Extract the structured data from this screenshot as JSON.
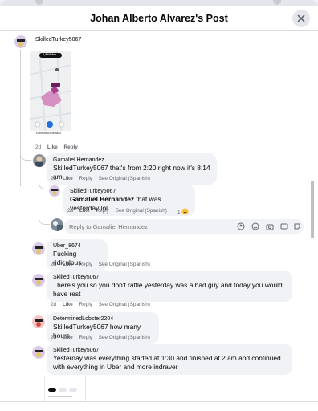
{
  "header": {
    "title": "Johan Alberto Alvarez's Post"
  },
  "comments": [
    {
      "author": "SkilledTurkey5067",
      "time": "2d",
      "like": "Like",
      "reply": "Reply",
      "image": {
        "chip": "1,944.4m",
        "pin_label": "",
        "footer": "Entre desconectado"
      }
    },
    {
      "author": "Gamaliel Hernandez",
      "text": "SkilledTurkey5067 that's from 2:20 right now it's 8:14 am",
      "time": "2d",
      "like": "Like",
      "reply": "Reply",
      "see_original": "See Original (Spanish)"
    },
    {
      "author": "SkilledTurkey5067",
      "mention": "Gamaliel Hernandez",
      "text": " that was yesterday lol",
      "time": "2d",
      "like": "Like",
      "reply": "Reply",
      "see_original": "See Original (Spanish)",
      "reactions": "1"
    },
    {
      "author": "Uber_8674",
      "text": "Fucking ridiculous",
      "time": "2d",
      "like": "Like",
      "reply": "Reply",
      "see_original": "See Original (Spanish)"
    },
    {
      "author": "SkilledTurkey5067",
      "text": "There's you so you don't raffle yesterday was a bad guy and today you would have rest",
      "time": "2d",
      "like": "Like",
      "reply": "Reply",
      "see_original": "See Original (Spanish)"
    },
    {
      "author": "DeterminedLobster2204",
      "text": "SkilledTurkey5067 how many hours",
      "time": "2d",
      "like": "Like",
      "reply": "Reply",
      "see_original": "See Original (Spanish)"
    },
    {
      "author": "SkilledTurkey5067",
      "text": "Yesterday was everything started at 1:30 and finished at 2 am and continued with everything in Uber and more indraver"
    }
  ],
  "reply_box": {
    "placeholder": "Reply to Gamaliel Hernandez"
  },
  "icons": [
    "avatar-sticker-icon",
    "emoji-icon",
    "camera-icon",
    "gif-icon",
    "sticker-icon"
  ],
  "colors": {
    "link": "#216fdb",
    "bubble": "#f0f2f5",
    "muted": "#65676b"
  }
}
